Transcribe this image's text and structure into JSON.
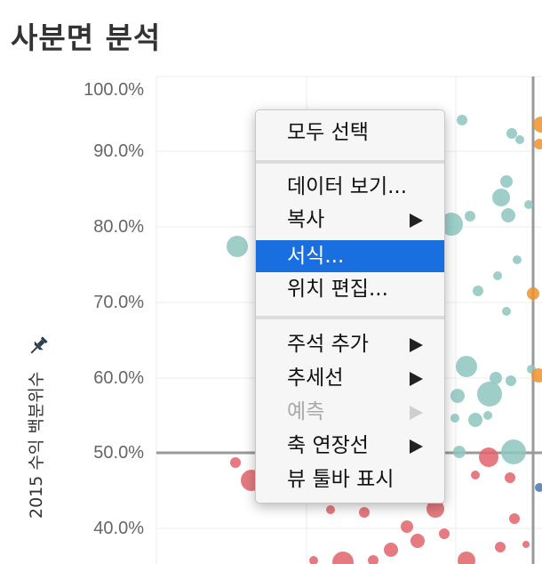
{
  "title": "사분면 분석",
  "y_axis": {
    "label": "2015 수익 백분위수",
    "ticks": [
      "100.0%",
      "90.0%",
      "80.0%",
      "70.0%",
      "60.0%",
      "50.0%",
      "40.0%"
    ]
  },
  "pin_icon": "pin-icon",
  "menu": {
    "select_all": "모두 선택",
    "view_data": "데이터 보기...",
    "copy": "복사",
    "format": "서식...",
    "edit_location": "위치 편집...",
    "add_annotation": "주석 추가",
    "trend_lines": "추세선",
    "forecast": "예측",
    "axis_extension": "축 연장선",
    "show_toolbar": "뷰 툴바 표시",
    "selected_item": "서식...",
    "disabled_item": "예측"
  },
  "colors": {
    "teal": "#8ec6c0",
    "red": "#e0646a",
    "orange": "#f0922e",
    "selection": "#1a6fe0"
  }
}
